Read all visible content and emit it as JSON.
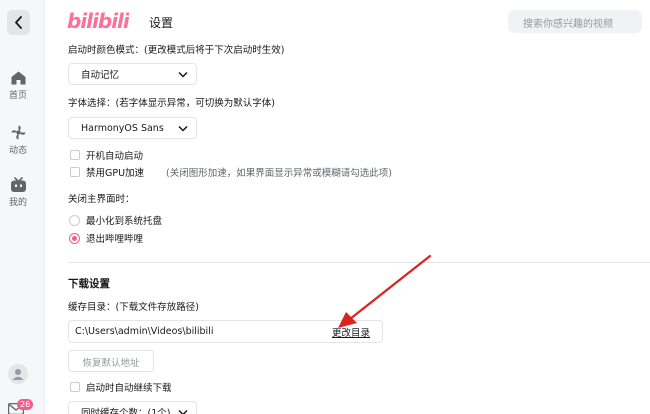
{
  "header": {
    "logo_text": "bilibili",
    "title": "设置",
    "search_placeholder": "搜索你感兴趣的视频"
  },
  "sidebar": {
    "items": [
      {
        "label": "首页",
        "icon": "home-icon"
      },
      {
        "label": "动态",
        "icon": "pinwheel-icon"
      },
      {
        "label": "我的",
        "icon": "tv-icon"
      }
    ],
    "message_badge": "26"
  },
  "settings": {
    "startup_color_label": "启动时颜色模式：(更改模式后将于下次启动时生效)",
    "startup_color_value": "自动记忆",
    "font_label": "字体选择：(若字体显示异常，可切换为默认字体)",
    "font_value": "HarmonyOS Sans",
    "autostart_label": "开机自动启动",
    "gpu_label": "禁用GPU加速",
    "gpu_hint": "(关闭图形加速，如果界面显示异常或模糊请勾选此项)",
    "close_label": "关闭主界面时：",
    "close_options": [
      "最小化到系统托盘",
      "退出哔哩哔哩"
    ],
    "close_selected": "退出哔哩哔哩"
  },
  "download": {
    "section_title": "下载设置",
    "cache_label": "缓存目录：(下载文件存放路径)",
    "cache_path": "C:\\Users\\admin\\Videos\\bilibili",
    "change_dir_link": "更改目录",
    "restore_button": "恢复默认地址",
    "resume_label": "启动时自动继续下载",
    "concurrent_label": "同时缓存个数：(1个)"
  },
  "colors": {
    "brand_pink": "#fb7299",
    "accent_pink": "#f25d8e",
    "annotation_arrow": "#d9241f"
  }
}
